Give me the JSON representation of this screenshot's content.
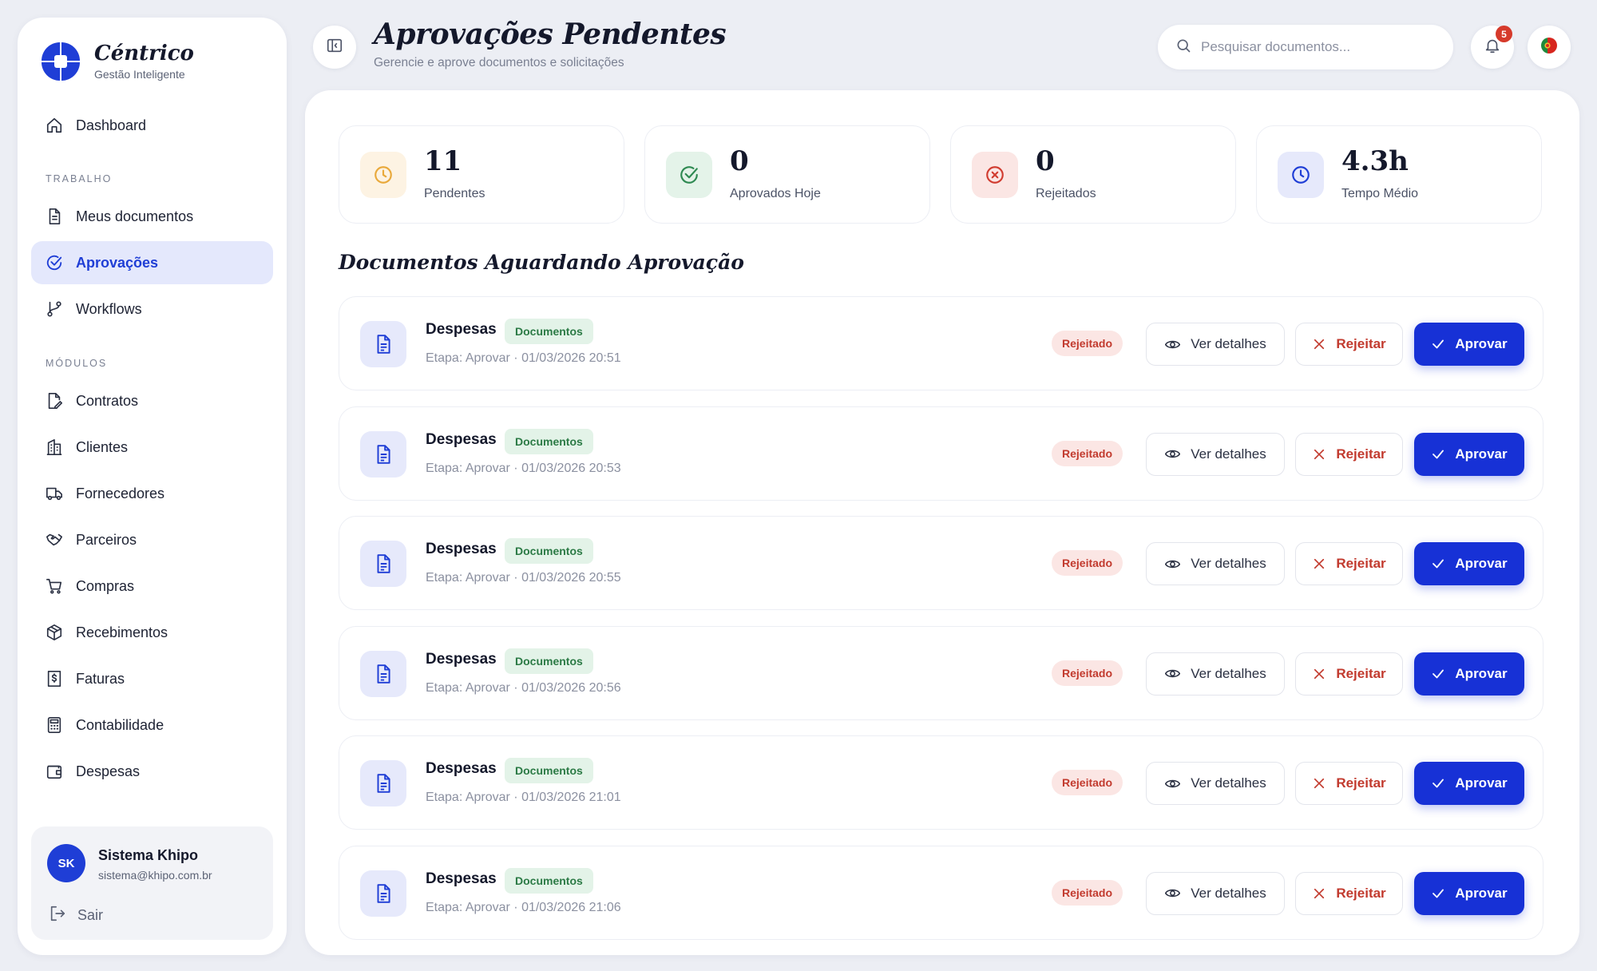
{
  "brand": {
    "name": "Céntrico",
    "subtitle": "Gestão Inteligente"
  },
  "sidebar": {
    "dashboard_label": "Dashboard",
    "section_work": "TRABALHO",
    "section_modules": "MÓDULOS",
    "work_items": [
      {
        "label": "Meus documentos",
        "icon": "file-text-icon"
      },
      {
        "label": "Aprovações",
        "icon": "check-circle-icon",
        "active": true
      },
      {
        "label": "Workflows",
        "icon": "git-branch-icon"
      }
    ],
    "module_items": [
      {
        "label": "Contratos",
        "icon": "file-signature-icon"
      },
      {
        "label": "Clientes",
        "icon": "building-icon"
      },
      {
        "label": "Fornecedores",
        "icon": "truck-icon"
      },
      {
        "label": "Parceiros",
        "icon": "handshake-icon"
      },
      {
        "label": "Compras",
        "icon": "cart-icon"
      },
      {
        "label": "Recebimentos",
        "icon": "package-icon"
      },
      {
        "label": "Faturas",
        "icon": "invoice-icon"
      },
      {
        "label": "Contabilidade",
        "icon": "calculator-icon"
      },
      {
        "label": "Despesas",
        "icon": "wallet-icon"
      }
    ]
  },
  "user": {
    "initials": "SK",
    "name": "Sistema Khipo",
    "email": "sistema@khipo.com.br",
    "logout_label": "Sair"
  },
  "header": {
    "title": "Aprovações Pendentes",
    "subtitle": "Gerencie e aprove documentos e solicitações",
    "search_placeholder": "Pesquisar documentos...",
    "notification_count": "5"
  },
  "stats": [
    {
      "value": "11",
      "label": "Pendentes",
      "icon": "clock-icon",
      "color": "#e9a93b",
      "bg": "#fdf3e3"
    },
    {
      "value": "0",
      "label": "Aprovados Hoje",
      "icon": "check-circle-icon",
      "color": "#2f8a52",
      "bg": "#e4f3e9"
    },
    {
      "value": "0",
      "label": "Rejeitados",
      "icon": "x-circle-icon",
      "color": "#d13c30",
      "bg": "#fbe6e4"
    },
    {
      "value": "4.3h",
      "label": "Tempo Médio",
      "icon": "clock-icon",
      "color": "#1f3ed6",
      "bg": "#e6e9fb"
    }
  ],
  "section_title": "Documentos Aguardando Aprovação",
  "actions": {
    "details": "Ver detalhes",
    "reject": "Rejeitar",
    "approve": "Aprovar"
  },
  "documents": [
    {
      "name": "Despesas",
      "tag": "Documentos",
      "meta": "Etapa: Aprovar · 01/03/2026 20:51",
      "status": "Rejeitado"
    },
    {
      "name": "Despesas",
      "tag": "Documentos",
      "meta": "Etapa: Aprovar · 01/03/2026 20:53",
      "status": "Rejeitado"
    },
    {
      "name": "Despesas",
      "tag": "Documentos",
      "meta": "Etapa: Aprovar · 01/03/2026 20:55",
      "status": "Rejeitado"
    },
    {
      "name": "Despesas",
      "tag": "Documentos",
      "meta": "Etapa: Aprovar · 01/03/2026 20:56",
      "status": "Rejeitado"
    },
    {
      "name": "Despesas",
      "tag": "Documentos",
      "meta": "Etapa: Aprovar · 01/03/2026 21:01",
      "status": "Rejeitado"
    },
    {
      "name": "Despesas",
      "tag": "Documentos",
      "meta": "Etapa: Aprovar · 01/03/2026 21:06",
      "status": "Rejeitado"
    }
  ],
  "colors": {
    "accent": "#1731d6",
    "accent_soft": "#e4e8fc",
    "reject": "#c23a2e",
    "tag_green": "#2b7a45"
  }
}
